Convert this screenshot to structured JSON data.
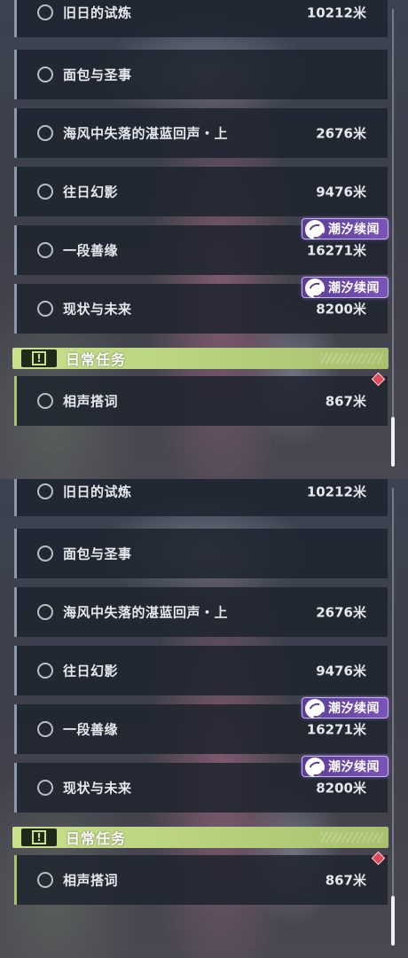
{
  "tasks": [
    {
      "name": "旧日的试炼",
      "distance": "10212米",
      "event": ""
    },
    {
      "name": "面包与圣事",
      "distance": "",
      "event": ""
    },
    {
      "name": "海风中失落的湛蓝回声・上",
      "distance": "2676米",
      "event": ""
    },
    {
      "name": "往日幻影",
      "distance": "9476米",
      "event": ""
    },
    {
      "name": "一段善缘",
      "distance": "16271米",
      "event": "潮汐续闻"
    },
    {
      "name": "现状与未来",
      "distance": "8200米",
      "event": "潮汐续闻"
    }
  ],
  "daily_section": {
    "title": "日常任务",
    "icon": "exclamation-icon",
    "tasks": [
      {
        "name": "相声搭词",
        "distance": "867米"
      }
    ]
  },
  "colors": {
    "event_badge": "#6b4aa8",
    "daily_header": "#c3dc86",
    "red_marker": "#e0495c"
  }
}
